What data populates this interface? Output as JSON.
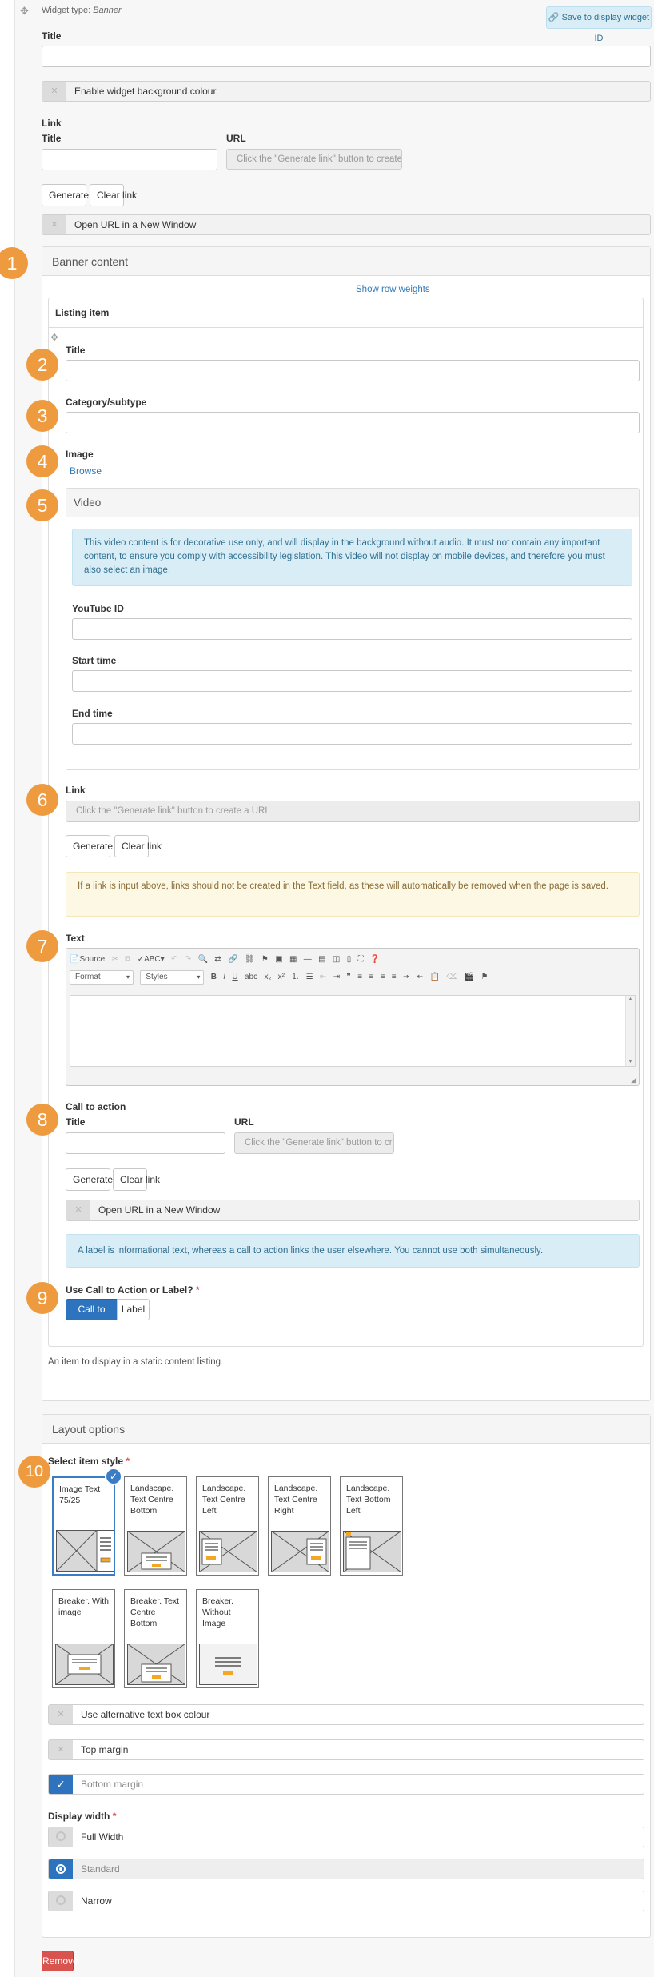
{
  "widget": {
    "type_label": "Widget type:",
    "type_value": "Banner",
    "save_button": "Save to display widget ID",
    "title_label": "Title",
    "bg_toggle": "Enable widget background colour",
    "link_heading": "Link",
    "link_title_label": "Title",
    "link_url_label": "URL",
    "link_url_placeholder": "Click the \"Generate link\" button to create a URL",
    "generate_link": "Generate link",
    "clear_link": "Clear link",
    "new_window": "Open URL in a New Window",
    "remove": "Remove"
  },
  "markers": [
    "1",
    "2",
    "3",
    "4",
    "5",
    "6",
    "7",
    "8",
    "9",
    "10"
  ],
  "banner": {
    "heading": "Banner content",
    "show_row_weights": "Show row weights",
    "listing_item": "Listing item",
    "title_label": "Title",
    "category_label": "Category/subtype",
    "image_label": "Image",
    "browse": "Browse",
    "video": {
      "heading": "Video",
      "info": "This video content is for decorative use only, and will display in the background without audio. It must not contain any important content, to ensure you comply with accessibility legislation. This video will not display on mobile devices, and therefore you must also select an image.",
      "youtube_label": "YouTube ID",
      "start_label": "Start time",
      "end_label": "End time"
    },
    "link_label": "Link",
    "link_placeholder": "Click the \"Generate link\" button to create a URL",
    "generate_link": "Generate link",
    "clear_link": "Clear link",
    "link_warning": "If a link is input above, links should not be created in the Text field, as these will automatically be removed when the page is saved.",
    "text_label": "Text",
    "editor": {
      "source": "Source",
      "format": "Format",
      "styles": "Styles"
    },
    "cta": {
      "heading": "Call to action",
      "title_label": "Title",
      "url_label": "URL",
      "url_placeholder": "Click the \"Generate link\" button to create a URL",
      "generate_link": "Generate link",
      "clear_link": "Clear link",
      "new_window": "Open URL in a New Window",
      "info": "A label is informational text, whereas a call to action links the user elsewhere. You cannot use both simultaneously."
    },
    "choice": {
      "label": "Use Call to Action or Label?",
      "required": "*",
      "options": [
        "Call to action",
        "Label"
      ],
      "selected": "Call to action"
    },
    "description": "An item to display in a static content listing"
  },
  "layout": {
    "heading": "Layout options",
    "style_label": "Select item style",
    "required": "*",
    "styles": [
      "Image Text 75/25",
      "Landscape. Text Centre Bottom",
      "Landscape. Text Centre Left",
      "Landscape. Text Centre Right",
      "Landscape. Text Bottom Left",
      "Breaker. With image",
      "Breaker. Text Centre Bottom",
      "Breaker. Without Image"
    ],
    "selected_style": "Image Text 75/25",
    "toggles": [
      {
        "label": "Use alternative text box colour",
        "checked": false
      },
      {
        "label": "Top margin",
        "checked": false
      },
      {
        "label": "Bottom margin",
        "checked": true
      }
    ],
    "width_label": "Display width",
    "widths": [
      {
        "label": "Full Width",
        "selected": false
      },
      {
        "label": "Standard",
        "selected": true
      },
      {
        "label": "Narrow",
        "selected": false
      }
    ]
  },
  "colors": {
    "marker": "#ee9a3f",
    "primary": "#2d73bd",
    "danger": "#d9534f",
    "info_bg": "#d9edf7",
    "warn_bg": "#fcf8e3"
  }
}
